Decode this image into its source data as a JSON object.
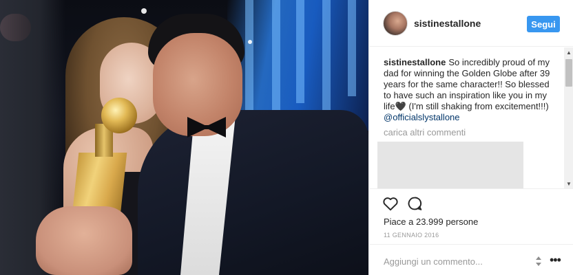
{
  "post": {
    "username": "sistinestallone",
    "follow_label": "Segui",
    "caption": {
      "user": "sistinestallone",
      "text": "So incredibly proud of my dad for winning the Golden Globe after 39 years for the same character!! So blessed to have such an inspiration like you in my life🖤 (I'm still shaking from excitement!!!)",
      "mention": "@officialslystallone"
    },
    "load_more_label": "carica altri commenti",
    "likes_text": "Piace a 23.999 persone",
    "date": "11 GENNAIO 2016",
    "comment_placeholder": "Aggiungi un commento..."
  },
  "icons": {
    "like": "heart-outline-icon",
    "comment": "speech-bubble-icon",
    "sort": "sort-arrows-icon",
    "more": "more-options-icon"
  },
  "colors": {
    "accent": "#3897f0",
    "text": "#262626",
    "muted": "#999999",
    "mention": "#003569",
    "divider": "#efefef"
  }
}
